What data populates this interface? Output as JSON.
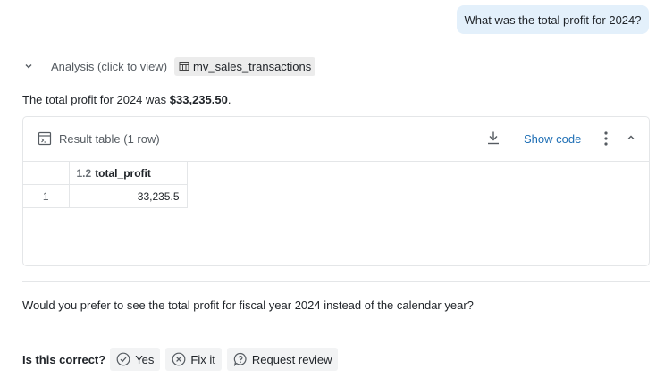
{
  "user_message": "What was the total profit for 2024?",
  "analysis": {
    "label": "Analysis (click to view)",
    "source_chip": "mv_sales_transactions"
  },
  "answer": {
    "prefix": "The total profit for 2024 was ",
    "value": "$33,235.50",
    "suffix": "."
  },
  "result_table": {
    "title": "Result table (1 row)",
    "show_code_label": "Show code",
    "columns": [
      {
        "type_tag": "1.2",
        "name": "total_profit"
      }
    ],
    "rows": [
      {
        "index": "1",
        "total_profit": "33,235.5"
      }
    ]
  },
  "followup_question": "Would you prefer to see the total profit for fiscal year 2024 instead of the calendar year?",
  "feedback": {
    "label": "Is this correct?",
    "yes_label": "Yes",
    "fix_label": "Fix it",
    "review_label": "Request review"
  }
}
